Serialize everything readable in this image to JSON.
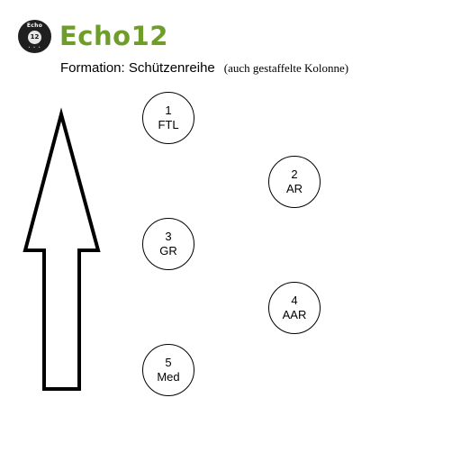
{
  "logo": {
    "brand": "Echo12",
    "badge_top": "Echo",
    "badge_number": "12",
    "badge_bottom": "• • •",
    "brand_color": "#6f9d2a"
  },
  "headline": {
    "main": "Formation: Schützenreihe",
    "sub": "(auch gestaffelte Kolonne)"
  },
  "positions": [
    {
      "number": "1",
      "role": "FTL"
    },
    {
      "number": "2",
      "role": "AR"
    },
    {
      "number": "3",
      "role": "GR"
    },
    {
      "number": "4",
      "role": "AAR"
    },
    {
      "number": "5",
      "role": "Med"
    }
  ],
  "direction_arrow": {
    "direction": "up",
    "icon": "up-arrow-icon"
  }
}
